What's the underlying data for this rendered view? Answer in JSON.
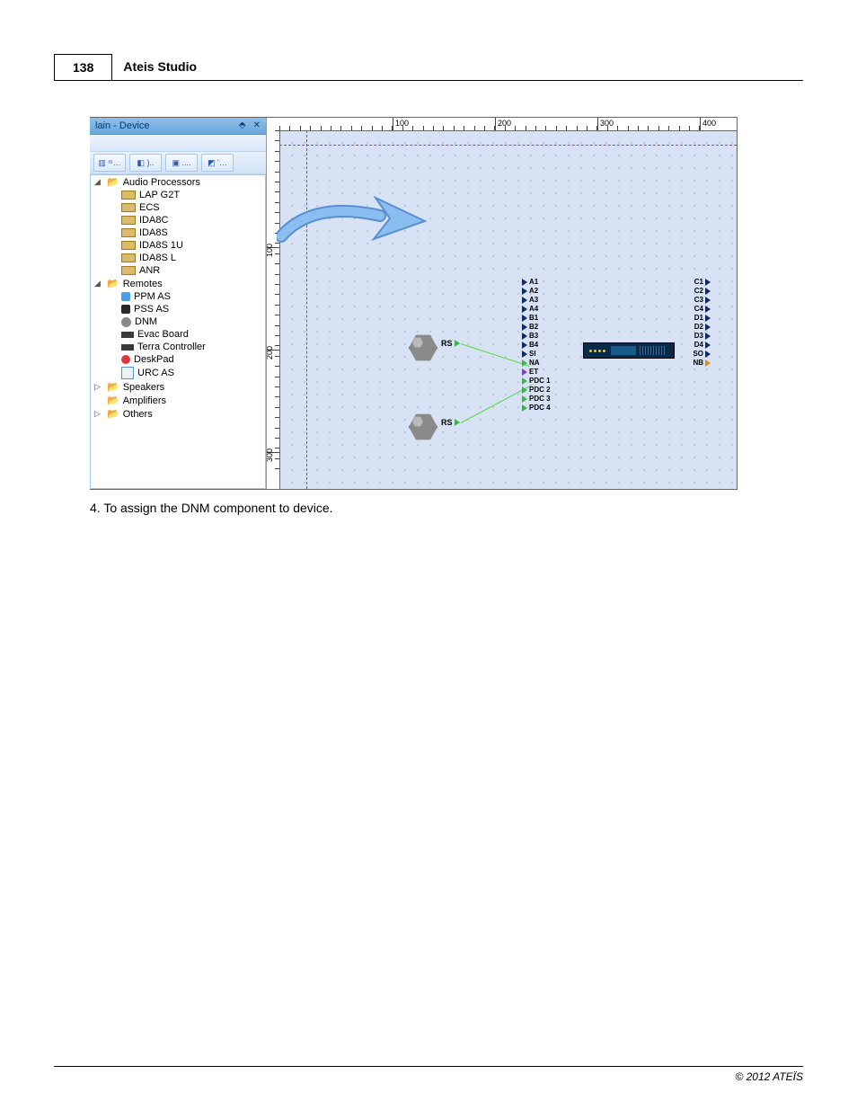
{
  "page_number": "138",
  "title": "Ateis Studio",
  "panel": {
    "title": "lain - Device",
    "tree": {
      "audio_processors": {
        "label": "Audio Processors",
        "items": [
          "LAP G2T",
          "ECS",
          "IDA8C",
          "IDA8S",
          "IDA8S 1U",
          "IDA8S L",
          "ANR"
        ]
      },
      "remotes": {
        "label": "Remotes",
        "items": [
          "PPM AS",
          "PSS AS",
          "DNM",
          "Evac Board",
          "Terra Controller",
          "DeskPad",
          "URC AS"
        ]
      },
      "collapsed": [
        "Speakers",
        "Amplifiers",
        "Others"
      ]
    }
  },
  "ruler": {
    "top_marks": [
      100,
      200,
      300,
      400
    ],
    "left_marks": [
      100,
      200,
      300
    ]
  },
  "components": {
    "dnm1": {
      "rs": "RS"
    },
    "dnm2": {
      "rs": "RS"
    },
    "ports_left": [
      "A1",
      "A2",
      "A3",
      "A4",
      "B1",
      "B2",
      "B3",
      "B4",
      "SI",
      "NA",
      "ET",
      "PDC 1",
      "PDC 2",
      "PDC 3",
      "PDC 4"
    ],
    "ports_right": [
      "C1",
      "C2",
      "C3",
      "C4",
      "D1",
      "D2",
      "D3",
      "D4",
      "SO",
      "NB"
    ]
  },
  "caption": "4. To assign the DNM component to device.",
  "footer": "© 2012 ATEÏS"
}
